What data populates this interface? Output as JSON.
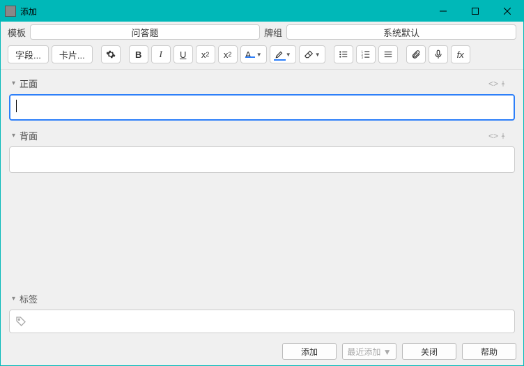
{
  "window": {
    "title": "添加"
  },
  "topbar": {
    "template_label": "模板",
    "template_value": "问答题",
    "deck_label": "牌组",
    "deck_value": "系统默认"
  },
  "toolbar": {
    "fields": "字段...",
    "cards": "卡片...",
    "fx": "fx"
  },
  "fields": [
    {
      "label": "正面",
      "focused": true
    },
    {
      "label": "背面",
      "focused": false
    }
  ],
  "tags": {
    "label": "标签"
  },
  "buttons": {
    "add": "添加",
    "history": "最近添加 ▼",
    "close": "关闭",
    "help": "帮助"
  }
}
